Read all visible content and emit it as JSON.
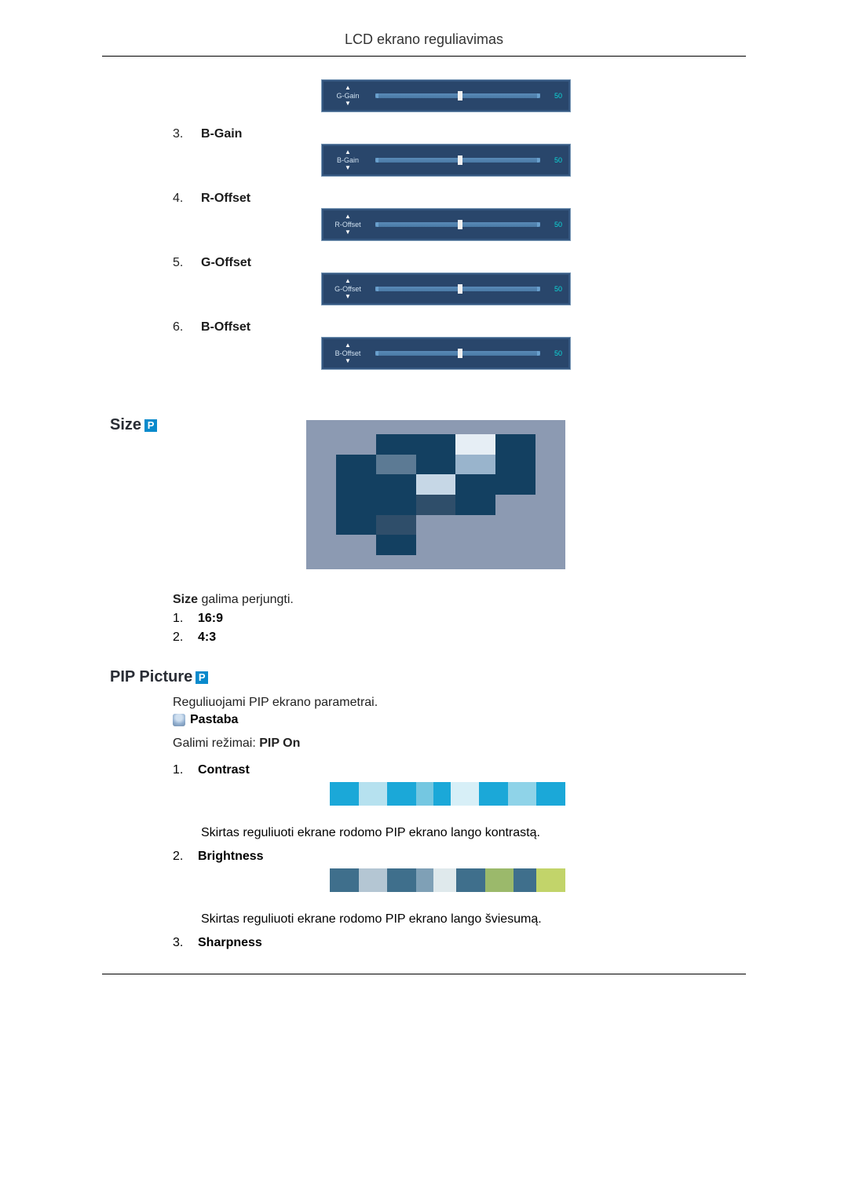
{
  "header": {
    "title": "LCD ekrano reguliavimas"
  },
  "sliders": [
    {
      "name": "G-Gain",
      "value": "50"
    },
    {
      "name": "B-Gain",
      "value": "50"
    },
    {
      "name": "R-Offset",
      "value": "50"
    },
    {
      "name": "G-Offset",
      "value": "50"
    },
    {
      "name": "B-Offset",
      "value": "50"
    }
  ],
  "gain_items": [
    {
      "num": "3.",
      "label": "B-Gain"
    },
    {
      "num": "4.",
      "label": "R-Offset"
    },
    {
      "num": "5.",
      "label": "G-Offset"
    },
    {
      "num": "6.",
      "label": "B-Offset"
    }
  ],
  "size_section": {
    "title": "Size",
    "icon_label": "P",
    "caption_prefix": "Size",
    "caption_rest": " galima perjungti.",
    "options": [
      {
        "num": "1.",
        "label": "16:9"
      },
      {
        "num": "2.",
        "label": "4:3"
      }
    ]
  },
  "pip_section": {
    "title": "PIP Picture",
    "icon_label": "P",
    "intro": "Reguliuojami PIP ekrano parametrai.",
    "note_label": "Pastaba",
    "modes_prefix": "Galimi režimai: ",
    "modes_bold": "PIP On",
    "items": [
      {
        "num": "1.",
        "label": "Contrast",
        "desc": "Skirtas reguliuoti ekrane rodomo PIP ekrano lango kontrastą."
      },
      {
        "num": "2.",
        "label": "Brightness",
        "desc": "Skirtas reguliuoti ekrane rodomo PIP ekrano lango šviesumą."
      },
      {
        "num": "3.",
        "label": "Sharpness",
        "desc": ""
      }
    ]
  }
}
